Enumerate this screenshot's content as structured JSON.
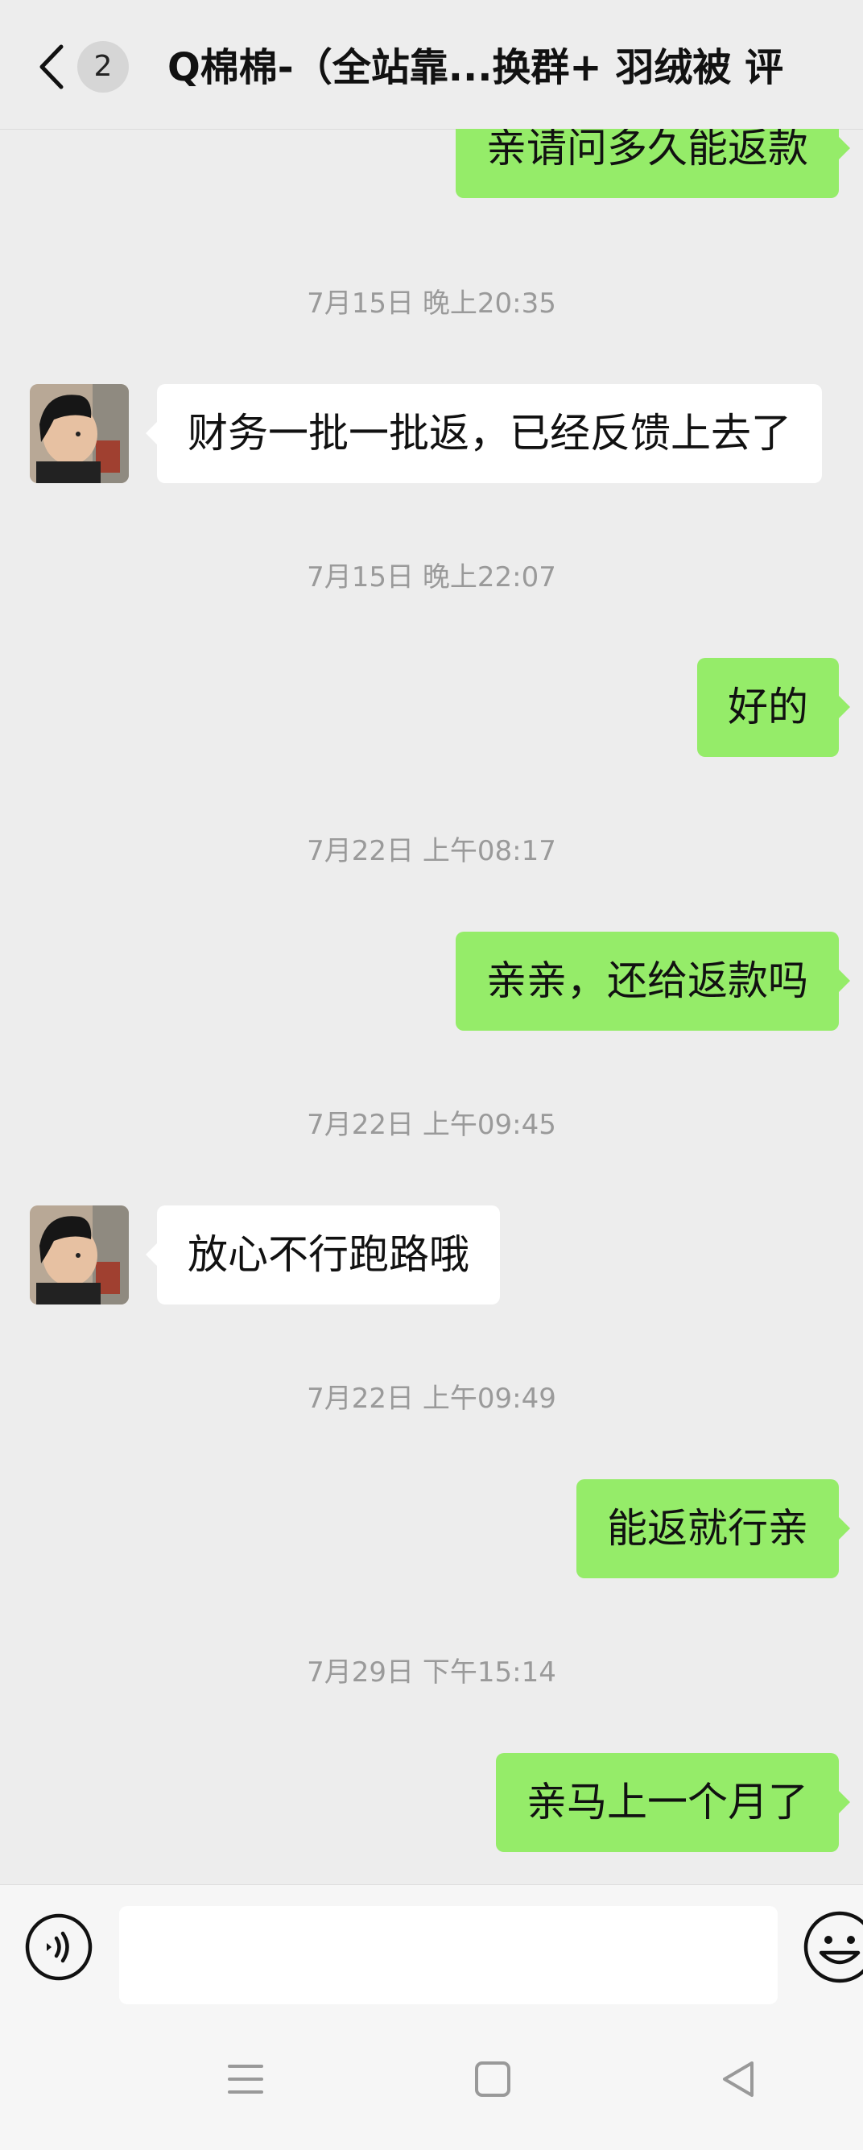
{
  "header": {
    "back_icon": "chevron-left-icon",
    "unread_count": "2",
    "title": "Q棉棉-（全站靠...换群+ 羽绒被 评"
  },
  "messages": [
    {
      "kind": "message",
      "direction": "out",
      "text": "亲请问多久能返款"
    },
    {
      "kind": "timestamp",
      "text": "7月15日 晚上20:35"
    },
    {
      "kind": "message",
      "direction": "in",
      "text": "财务一批一批返，已经反馈上去了"
    },
    {
      "kind": "timestamp",
      "text": "7月15日 晚上22:07"
    },
    {
      "kind": "message",
      "direction": "out",
      "text": "好的"
    },
    {
      "kind": "timestamp",
      "text": "7月22日 上午08:17"
    },
    {
      "kind": "message",
      "direction": "out",
      "text": "亲亲，还给返款吗"
    },
    {
      "kind": "timestamp",
      "text": "7月22日 上午09:45"
    },
    {
      "kind": "message",
      "direction": "in",
      "text": "放心不行跑路哦"
    },
    {
      "kind": "timestamp",
      "text": "7月22日 上午09:49"
    },
    {
      "kind": "message",
      "direction": "out",
      "text": "能返就行亲"
    },
    {
      "kind": "timestamp",
      "text": "7月29日 下午15:14"
    },
    {
      "kind": "message",
      "direction": "out",
      "text": "亲马上一个月了"
    }
  ],
  "input_bar": {
    "voice_icon": "voice-input-icon",
    "input_value": "",
    "emoji_icon": "emoji-icon"
  },
  "nav_bar": {
    "icons": [
      "menu-icon",
      "home-icon",
      "back-triangle-icon"
    ]
  },
  "colors": {
    "outgoing_bubble": "#95ec69",
    "incoming_bubble": "#ffffff",
    "background": "#ededed",
    "timestamp_text": "#9a9a9a"
  }
}
